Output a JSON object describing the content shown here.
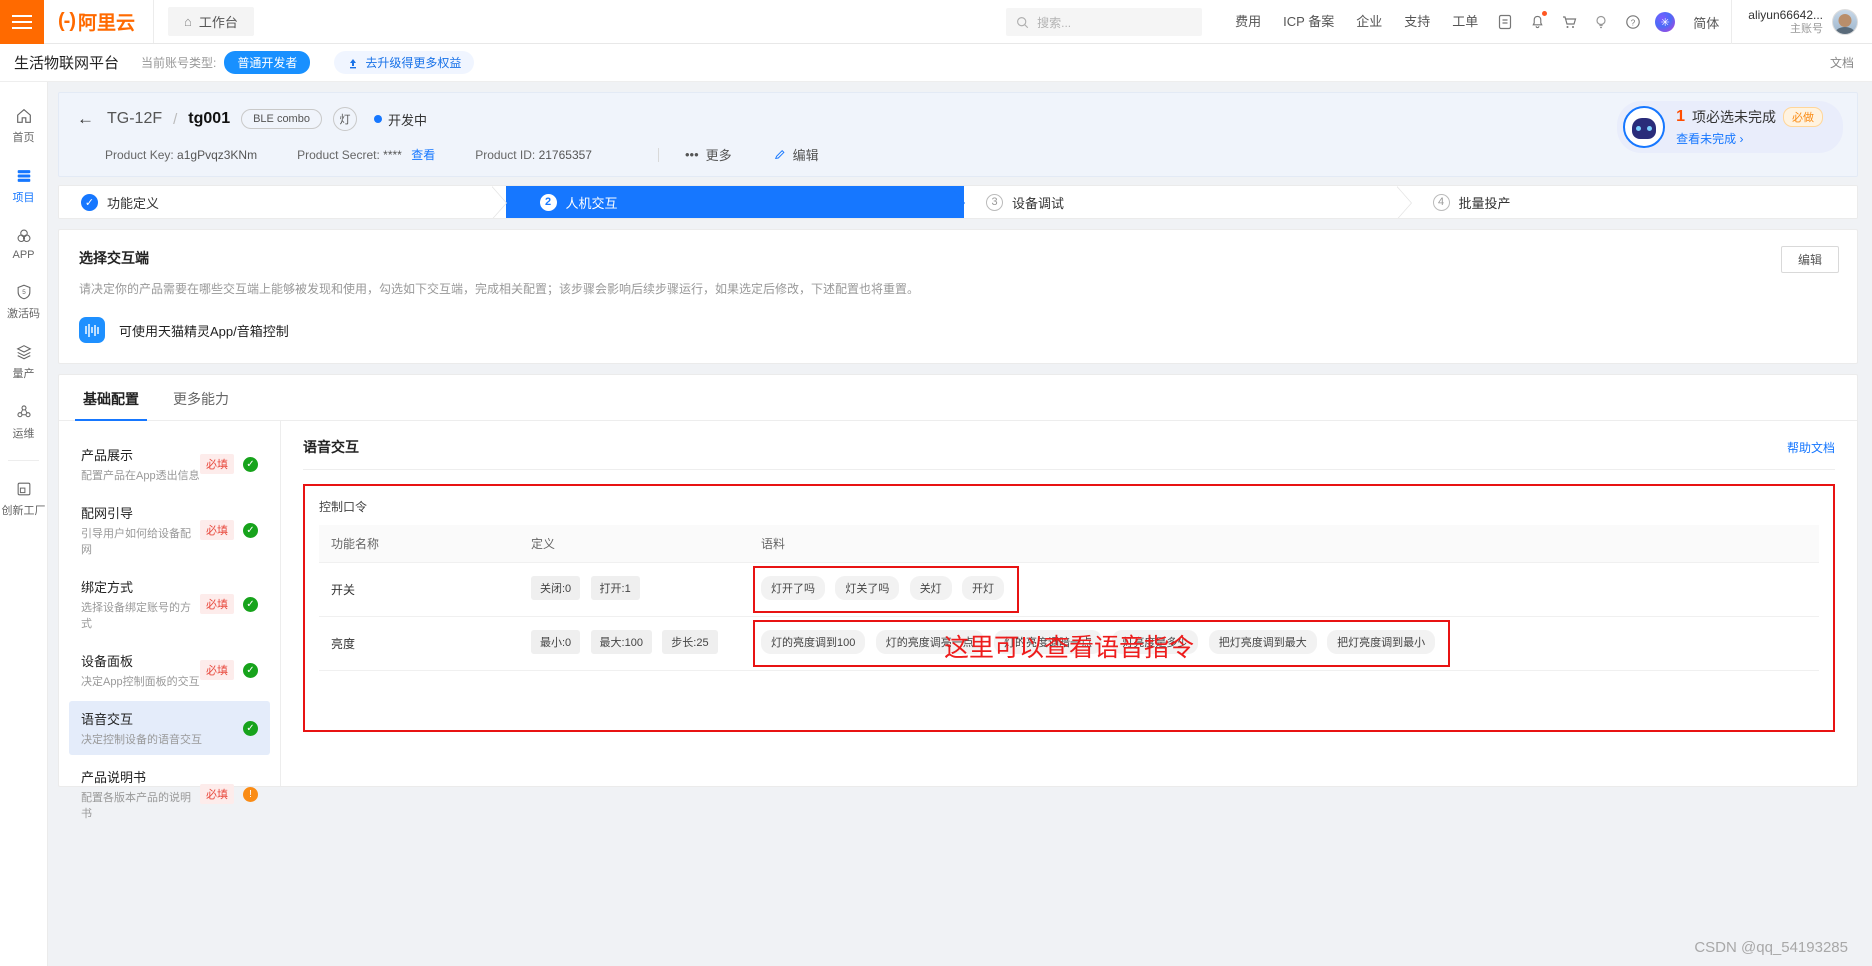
{
  "topbar": {
    "menu_icon": "hamburger-icon",
    "logo_mark": "(-)",
    "logo_text": "阿里云",
    "workbench_label": "工作台",
    "home_icon": "home-icon",
    "search_placeholder": "搜索...",
    "search_icon": "search-icon",
    "nav": [
      {
        "label": "费用"
      },
      {
        "label": "ICP 备案"
      },
      {
        "label": "企业"
      },
      {
        "label": "支持"
      },
      {
        "label": "工单"
      }
    ],
    "icons": [
      {
        "name": "app-grid-icon",
        "glyph": "▣"
      },
      {
        "name": "bell-icon",
        "glyph": "🔔"
      },
      {
        "name": "cart-icon",
        "glyph": "🛒"
      },
      {
        "name": "bulb-icon",
        "glyph": "♀"
      },
      {
        "name": "help-circle-icon",
        "glyph": "?"
      }
    ],
    "ai_icon": "ai-assistant-icon",
    "language": "简体",
    "account_name": "aliyun66642...",
    "account_role": "主账号",
    "avatar": "user-avatar"
  },
  "platbar": {
    "title": "生活物联网平台",
    "account_type_label": "当前账号类型:",
    "account_type_value": "普通开发者",
    "upgrade_label": "去升级得更多权益",
    "upgrade_icon": "upload-arrow-icon",
    "doc_label": "文档"
  },
  "rail": {
    "items": [
      {
        "label": "首页",
        "icon": "home-icon",
        "glyph": "⌂",
        "active": false
      },
      {
        "label": "项目",
        "icon": "project-icon",
        "glyph": "▤",
        "active": true
      },
      {
        "label": "APP",
        "icon": "app-icon",
        "glyph": "⚇",
        "active": false
      },
      {
        "label": "激活码",
        "icon": "activation-code-icon",
        "glyph": "⑤",
        "active": false
      },
      {
        "label": "量产",
        "icon": "mass-production-icon",
        "glyph": "≋",
        "active": false
      },
      {
        "label": "运维",
        "icon": "ops-icon",
        "glyph": "⚭",
        "active": false
      },
      {
        "label": "创新工厂",
        "icon": "innovation-factory-icon",
        "glyph": "▯",
        "active": false
      }
    ]
  },
  "product_header": {
    "back_icon": "back-arrow-icon",
    "parent_name": "TG-12F",
    "separator": "/",
    "current_name": "tg001",
    "tag_combo": "BLE combo",
    "tag_category": "灯",
    "status": "开发中",
    "product_key_label": "Product Key:",
    "product_key": "a1gPvqz3KNm",
    "product_secret_label": "Product Secret:",
    "product_secret": "****",
    "product_secret_action": "查看",
    "product_id_label": "Product ID:",
    "product_id": "21765357",
    "more_label": "更多",
    "more_icon": "ellipsis-icon",
    "edit_label": "编辑",
    "edit_icon": "pencil-icon",
    "alert": {
      "icon": "robot-avatar-icon",
      "count": "1",
      "text": "项必选未完成",
      "badge": "必做",
      "link": "查看未完成",
      "chevron": "›"
    }
  },
  "steps": [
    {
      "num": "✓",
      "label": "功能定义",
      "state": "done"
    },
    {
      "num": "2",
      "label": "人机交互",
      "state": "active"
    },
    {
      "num": "3",
      "label": "设备调试",
      "state": "todo"
    },
    {
      "num": "4",
      "label": "批量投产",
      "state": "todo"
    }
  ],
  "channel_card": {
    "title": "选择交互端",
    "edit_label": "编辑",
    "description": "请决定你的产品需要在哪些交互端上能够被发现和使用，勾选如下交互端，完成相关配置；该步骤会影响后续步骤运行，如果选定后修改，下述配置也将重置。",
    "channel_icon": "tmall-genie-icon",
    "channel_label": "可使用天猫精灵App/音箱控制"
  },
  "config": {
    "tabs": [
      {
        "label": "基础配置",
        "active": true
      },
      {
        "label": "更多能力",
        "active": false
      }
    ],
    "items": [
      {
        "name": "产品展示",
        "sub": "配置产品在App透出信息",
        "required": "必填",
        "status": "ok",
        "selected": false
      },
      {
        "name": "配网引导",
        "sub": "引导用户如何给设备配网",
        "required": "必填",
        "status": "ok",
        "selected": false
      },
      {
        "name": "绑定方式",
        "sub": "选择设备绑定账号的方式",
        "required": "必填",
        "status": "ok",
        "selected": false
      },
      {
        "name": "设备面板",
        "sub": "决定App控制面板的交互",
        "required": "必填",
        "status": "ok",
        "selected": false
      },
      {
        "name": "语音交互",
        "sub": "决定控制设备的语音交互",
        "required": "",
        "status": "ok",
        "selected": true
      },
      {
        "name": "产品说明书",
        "sub": "配置各版本产品的说明书",
        "required": "必填",
        "status": "warn",
        "selected": false
      }
    ],
    "detail": {
      "title": "语音交互",
      "help_label": "帮助文档",
      "section_label": "控制口令",
      "table": {
        "headers": [
          "功能名称",
          "定义",
          "语料"
        ],
        "rows": [
          {
            "name": "开关",
            "definitions": [
              "关闭:0",
              "打开:1"
            ],
            "corpus": [
              "灯开了吗",
              "灯关了吗",
              "关灯",
              "开灯"
            ]
          },
          {
            "name": "亮度",
            "definitions": [
              "最小:0",
              "最大:100",
              "步长:25"
            ],
            "corpus": [
              "灯的亮度调到100",
              "灯的亮度调亮一点",
              "灯的亮度调暗一点",
              "灯亮度是多少",
              "把灯亮度调到最大",
              "把灯亮度调到最小"
            ]
          }
        ]
      },
      "annotation": "这里可以查看语音指令"
    }
  },
  "watermark": "CSDN @qq_54193285"
}
